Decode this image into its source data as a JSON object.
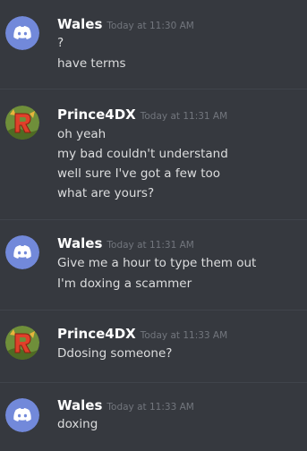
{
  "messages": [
    {
      "author": "Wales",
      "avatar_icon": "discord-default-avatar",
      "timestamp": "Today at 11:30 AM",
      "lines": [
        "?",
        "have terms"
      ]
    },
    {
      "author": "Prince4DX",
      "avatar_icon": "custom-r-logo-avatar",
      "timestamp": "Today at 11:31 AM",
      "lines": [
        "oh yeah",
        "my bad couldn't understand",
        "well sure I've got a few too",
        "what are yours?"
      ]
    },
    {
      "author": "Wales",
      "avatar_icon": "discord-default-avatar",
      "timestamp": "Today at 11:31 AM",
      "lines": [
        "Give  me a hour to type them out",
        "I'm doxing a scammer"
      ]
    },
    {
      "author": "Prince4DX",
      "avatar_icon": "custom-r-logo-avatar",
      "timestamp": "Today at 11:33 AM",
      "lines": [
        "Ddosing someone?"
      ]
    },
    {
      "author": "Wales",
      "avatar_icon": "discord-default-avatar",
      "timestamp": "Today at 11:33 AM",
      "lines": [
        "doxing"
      ]
    }
  ],
  "colors": {
    "background": "#36393f",
    "username": "#ffffff",
    "timestamp": "#72767d",
    "message_text": "#dcddde",
    "discord_avatar": "#7289da",
    "divider": "#40444b"
  }
}
